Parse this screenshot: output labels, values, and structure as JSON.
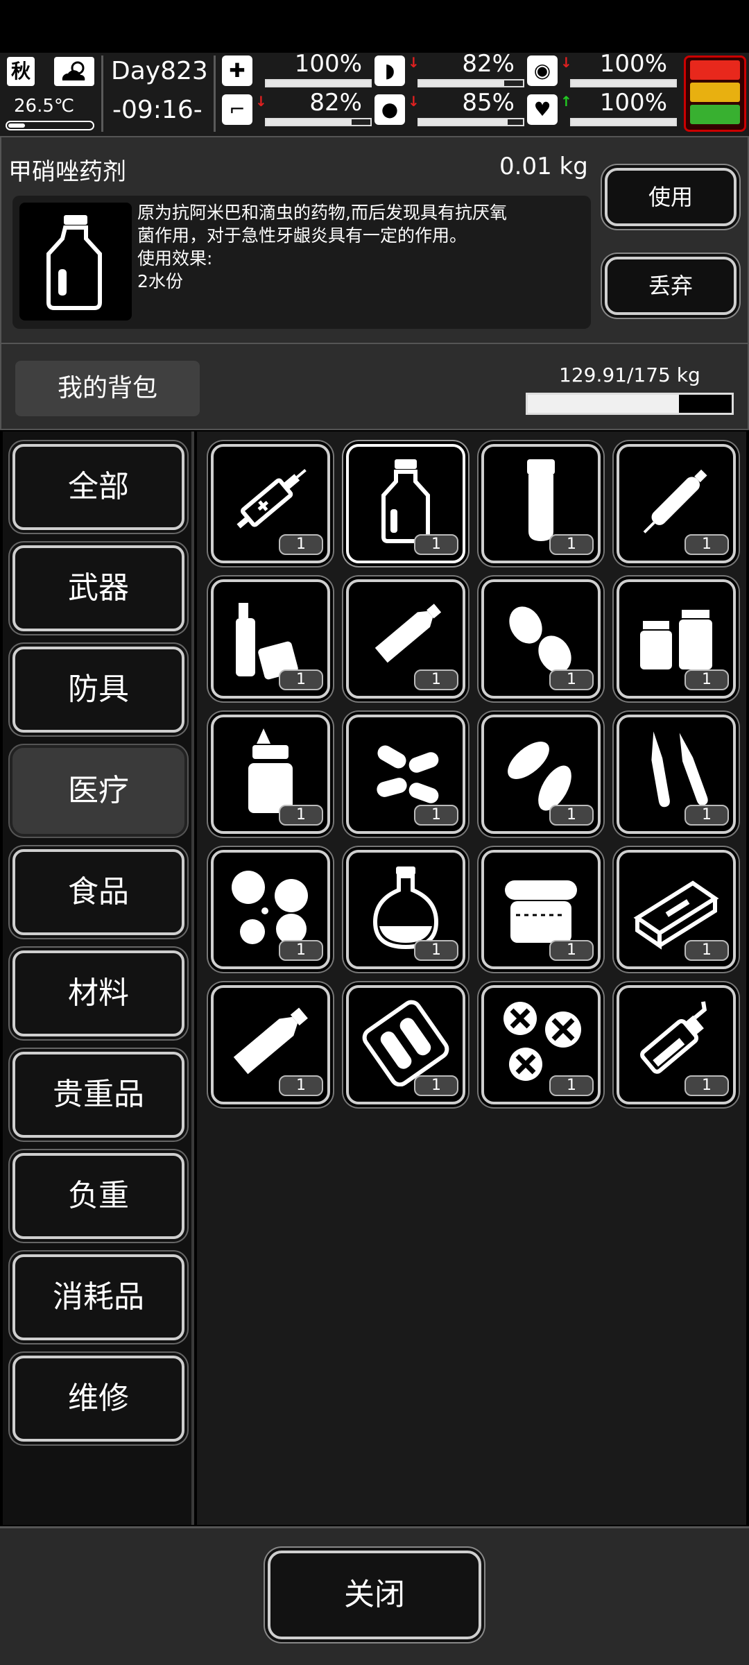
{
  "status": {
    "season": "秋",
    "temperature": "26.5℃",
    "day": "Day823",
    "time": "-09:16-",
    "stats": [
      {
        "icon": "medkit-icon",
        "glyph": "✚",
        "value": "100%",
        "level": 1.0,
        "arrow": "",
        "arrow_color": ""
      },
      {
        "icon": "stomach-icon",
        "glyph": "◗",
        "value": "82%",
        "level": 0.82,
        "arrow": "↓",
        "arrow_color": "#e02020"
      },
      {
        "icon": "bladder-icon",
        "glyph": "◉",
        "value": "100%",
        "level": 1.0,
        "arrow": "↓",
        "arrow_color": "#e02020"
      },
      {
        "icon": "leg-icon",
        "glyph": "⌐",
        "value": "82%",
        "level": 0.82,
        "arrow": "↓",
        "arrow_color": "#e02020"
      },
      {
        "icon": "water-drop-icon",
        "glyph": "●",
        "value": "85%",
        "level": 0.85,
        "arrow": "↓",
        "arrow_color": "#e02020"
      },
      {
        "icon": "heart-icon",
        "glyph": "♥",
        "value": "100%",
        "level": 1.0,
        "arrow": "↑",
        "arrow_color": "#22cc22"
      }
    ],
    "traffic_colors": [
      "#e8281c",
      "#e8b010",
      "#38b030"
    ]
  },
  "item": {
    "name": "甲硝唑药剂",
    "weight": "0.01 kg",
    "desc_lines": [
      "原为抗阿米巴和滴虫的药物,而后发现具有抗厌氧",
      "菌作用，对于急性牙龈炎具有一定的作用。",
      "使用效果:",
      "2水份"
    ],
    "use_label": "使用",
    "drop_label": "丢弃"
  },
  "bag": {
    "title": "我的背包",
    "capacity_text": "129.91/175 kg",
    "capacity_fraction": 0.742
  },
  "categories": [
    {
      "label": "全部",
      "active": false
    },
    {
      "label": "武器",
      "active": false
    },
    {
      "label": "防具",
      "active": false
    },
    {
      "label": "医疗",
      "active": true
    },
    {
      "label": "食品",
      "active": false
    },
    {
      "label": "材料",
      "active": false
    },
    {
      "label": "贵重品",
      "active": false
    },
    {
      "label": "负重",
      "active": false
    },
    {
      "label": "消耗品",
      "active": false
    },
    {
      "label": "维修",
      "active": false
    }
  ],
  "items": [
    {
      "icon": "syringe-icon",
      "count": "1"
    },
    {
      "icon": "medicine-bottle-icon",
      "count": "1",
      "selected": true
    },
    {
      "icon": "test-tube-icon",
      "count": "1"
    },
    {
      "icon": "injection-pen-icon",
      "count": "1"
    },
    {
      "icon": "spray-bottles-icon",
      "count": "1"
    },
    {
      "icon": "ointment-tube-icon",
      "count": "1"
    },
    {
      "icon": "tablets-icon",
      "count": "1"
    },
    {
      "icon": "pill-jars-icon",
      "count": "1"
    },
    {
      "icon": "dropper-bottle-icon",
      "count": "1"
    },
    {
      "icon": "capsules-icon",
      "count": "1"
    },
    {
      "icon": "oval-pills-icon",
      "count": "1"
    },
    {
      "icon": "ampoules-icon",
      "count": "1"
    },
    {
      "icon": "scored-pills-icon",
      "count": "1"
    },
    {
      "icon": "round-flask-icon",
      "count": "1"
    },
    {
      "icon": "ointment-jar-icon",
      "count": "1"
    },
    {
      "icon": "medicine-box-icon",
      "count": "1"
    },
    {
      "icon": "cream-tube-icon",
      "count": "1"
    },
    {
      "icon": "blister-pack-icon",
      "count": "1"
    },
    {
      "icon": "cross-tablets-icon",
      "count": "1"
    },
    {
      "icon": "spray-can-icon",
      "count": "1"
    }
  ],
  "footer": {
    "close_label": "关闭"
  }
}
